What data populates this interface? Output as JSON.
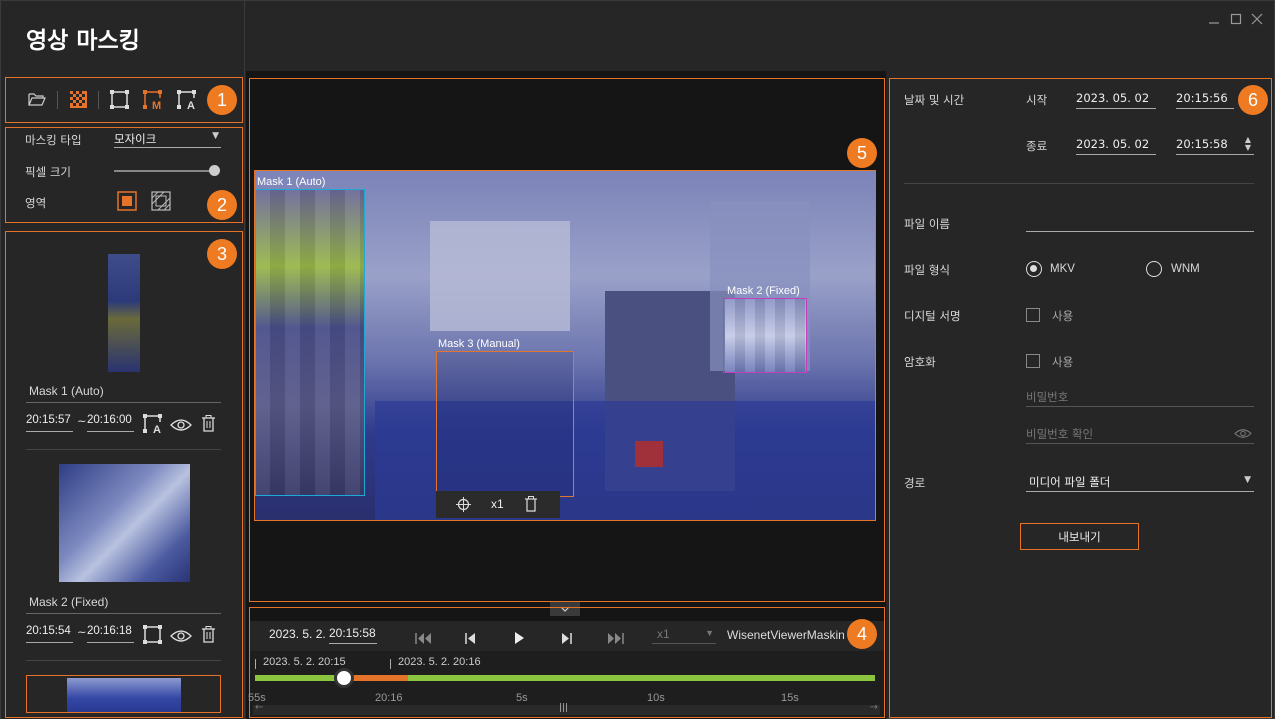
{
  "app": {
    "title": "영상 마스킹",
    "window_controls": [
      "minimize-icon",
      "maximize-icon",
      "close-icon"
    ]
  },
  "badges": [
    "1",
    "2",
    "3",
    "4",
    "5",
    "6"
  ],
  "toolbar": {
    "tools": [
      "folder-open-icon",
      "mosaic-icon",
      "mask-fixed-icon",
      "mask-manual-icon",
      "mask-auto-icon"
    ]
  },
  "settings": {
    "masking_type_label": "마스킹 타입",
    "masking_type_value": "모자이크",
    "pixel_size_label": "픽셀 크기",
    "area_label": "영역"
  },
  "mask_list": [
    {
      "name": "Mask 1 (Auto)",
      "start": "20:15:57",
      "tilde": "~",
      "end": "20:16:00"
    },
    {
      "name": "Mask 2 (Fixed)",
      "start": "20:15:54",
      "tilde": "~",
      "end": "20:16:18"
    }
  ],
  "video": {
    "masks": [
      {
        "label": "Mask 1 (Auto)",
        "color": "#1fa9d6"
      },
      {
        "label": "Mask 2 (Fixed)",
        "color": "#c43fbf"
      },
      {
        "label": "Mask 3 (Manual)",
        "color": "#e6732a"
      }
    ],
    "mask_speed": "x1"
  },
  "playback": {
    "date": "2023. 5. 2.",
    "time": "20:15:58",
    "speed": "x1",
    "filename": "WisenetViewerMaskin"
  },
  "timeline": {
    "marker1": "2023. 5. 2. 20:15",
    "marker2": "2023. 5. 2. 20:16",
    "ticks": [
      "55s",
      "20:16",
      "5s",
      "10s",
      "15s"
    ]
  },
  "export": {
    "datetime_label": "날짜 및 시간",
    "start_label": "시작",
    "start_date": "2023. 05. 02",
    "start_time": "20:15:56",
    "end_label": "종료",
    "end_date": "2023. 05. 02",
    "end_time": "20:15:58",
    "filename_label": "파일 이름",
    "filename_value": "",
    "format_label": "파일 형식",
    "format_mkv": "MKV",
    "format_wnm": "WNM",
    "signature_label": "디지털 서명",
    "signature_use": "사용",
    "encrypt_label": "암호화",
    "encrypt_use": "사용",
    "password_placeholder": "비밀번호",
    "password_confirm_placeholder": "비밀번호 확인",
    "path_label": "경로",
    "path_value": "미디어 파일 폴더",
    "export_button": "내보내기"
  },
  "colors": {
    "accent": "#e6732a",
    "timeline_green": "#8bc53f",
    "mask_auto": "#1fa9d6",
    "mask_fixed": "#c43fbf"
  }
}
